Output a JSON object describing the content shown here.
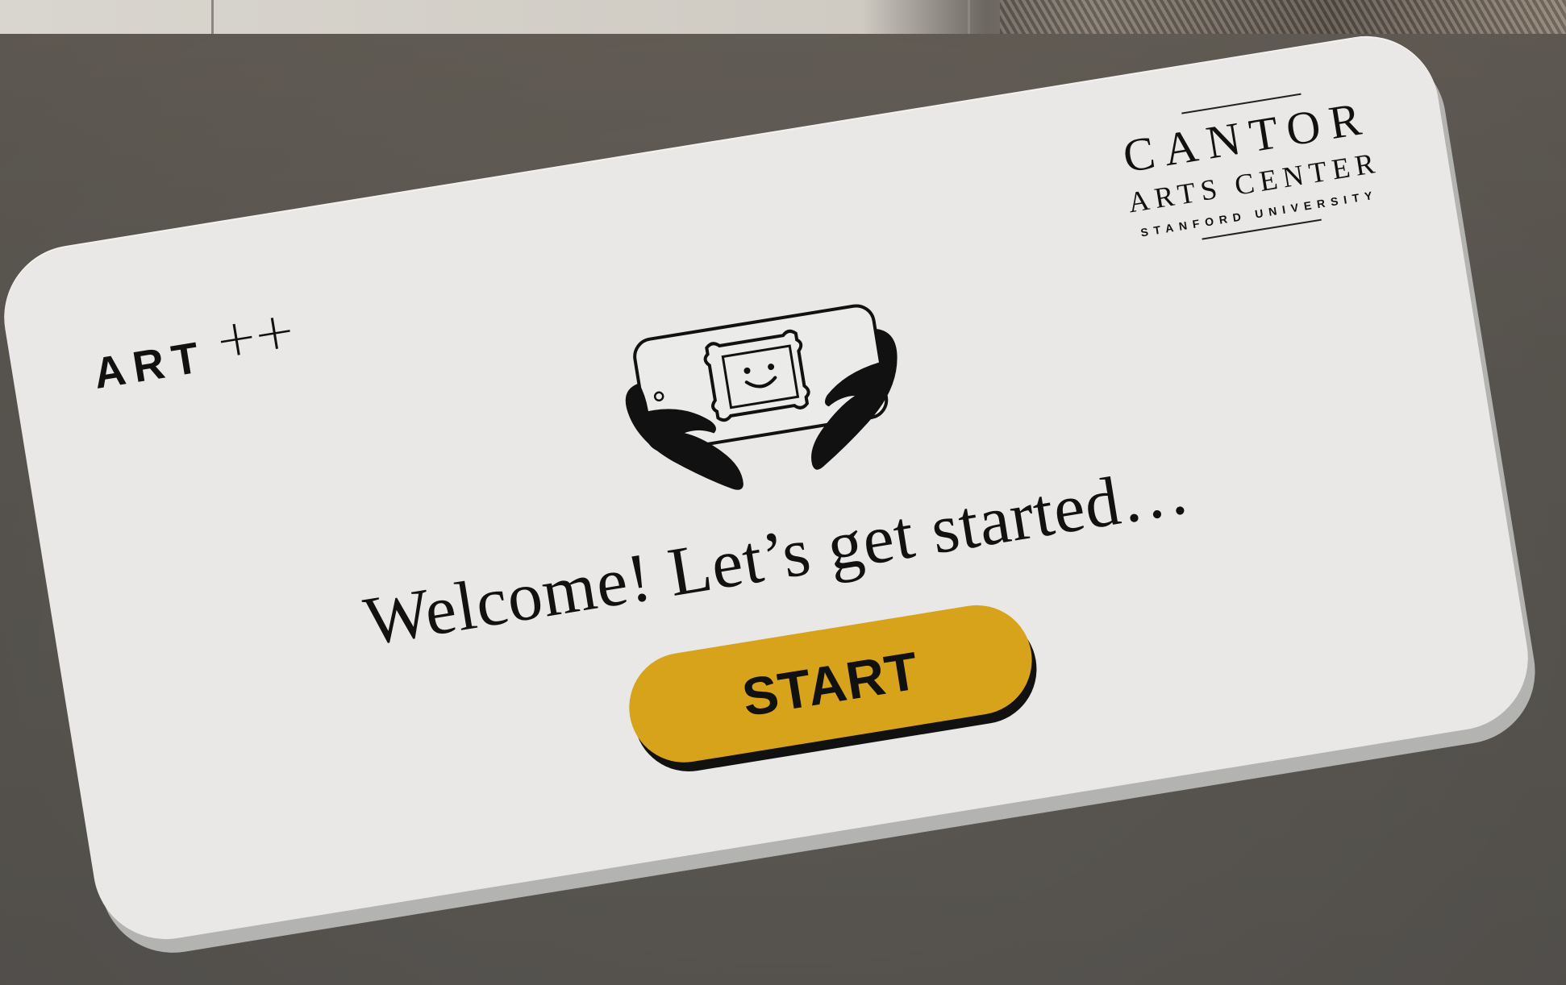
{
  "card": {
    "art_logo": {
      "word": "ART",
      "plus": "++"
    },
    "partner_logo": {
      "name": "CANTOR",
      "subtitle": "ARTS CENTER",
      "university": "STANFORD UNIVERSITY"
    },
    "hero_icon": "hands-holding-phone-icon",
    "welcome_text": "Welcome! Let’s get started…",
    "start_label": "START"
  },
  "colors": {
    "background": "#5e5a54",
    "card": "#e9e8e6",
    "card_edge": "#b3b3b1",
    "button": "#d7a31b",
    "ink": "#111111"
  }
}
